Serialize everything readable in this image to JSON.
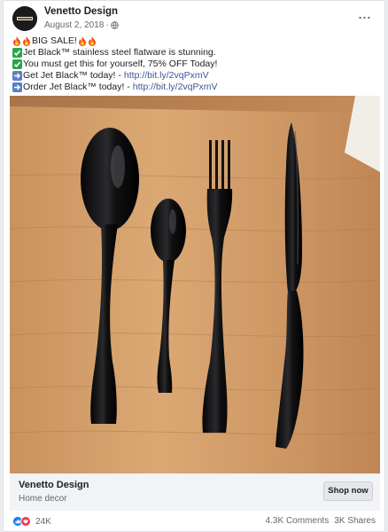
{
  "post": {
    "page_name": "Venetto Design",
    "date": "August 2, 2018",
    "separator": "·",
    "more_label": "...",
    "lines": {
      "l1": "BIG SALE!",
      "l2": "Jet Black™ stainless steel flatware is stunning.",
      "l3": "You must get this for yourself, 75% OFF Today!",
      "l4_text": "Get Jet Black™ today! -",
      "l4_link": "http://bit.ly/2vqPxmV",
      "l5_text": "Order Jet Black™ today! -",
      "l5_link": "http://bit.ly/2vqPxmV"
    }
  },
  "cta": {
    "title": "Venetto Design",
    "subtitle": "Home decor",
    "button": "Shop now"
  },
  "footer": {
    "reaction_count": "24K",
    "comments": "4.3K Comments",
    "shares": "3K Shares"
  },
  "colors": {
    "link": "#385898",
    "like": "#1877f2",
    "love": "#f33e58"
  },
  "icons": [
    "avatar-logo",
    "globe-icon",
    "fire-emoji",
    "check-emoji",
    "arrow-emoji",
    "like-icon",
    "love-icon"
  ]
}
